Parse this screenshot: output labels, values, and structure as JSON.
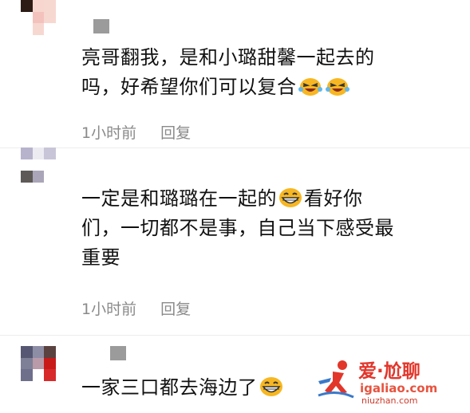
{
  "comments": [
    {
      "text_line1": "亮哥翻我，是和小璐甜馨一起去的",
      "text_line2": "吗，好希望你们可以复合",
      "time": "1小时前",
      "reply": "回复"
    },
    {
      "text_line1": "一定是和璐璐在一起的",
      "text_line1_after": "看好你",
      "text_line2": "们，一切都不是事，自己当下感受最",
      "text_line3": "重要",
      "time": "1小时前",
      "reply": "回复"
    },
    {
      "text_line1": "一家三口都去海边了"
    }
  ],
  "watermark": {
    "title": "爱·尬聊",
    "url": "igaliao.com",
    "url2": "niuzhan.com"
  }
}
